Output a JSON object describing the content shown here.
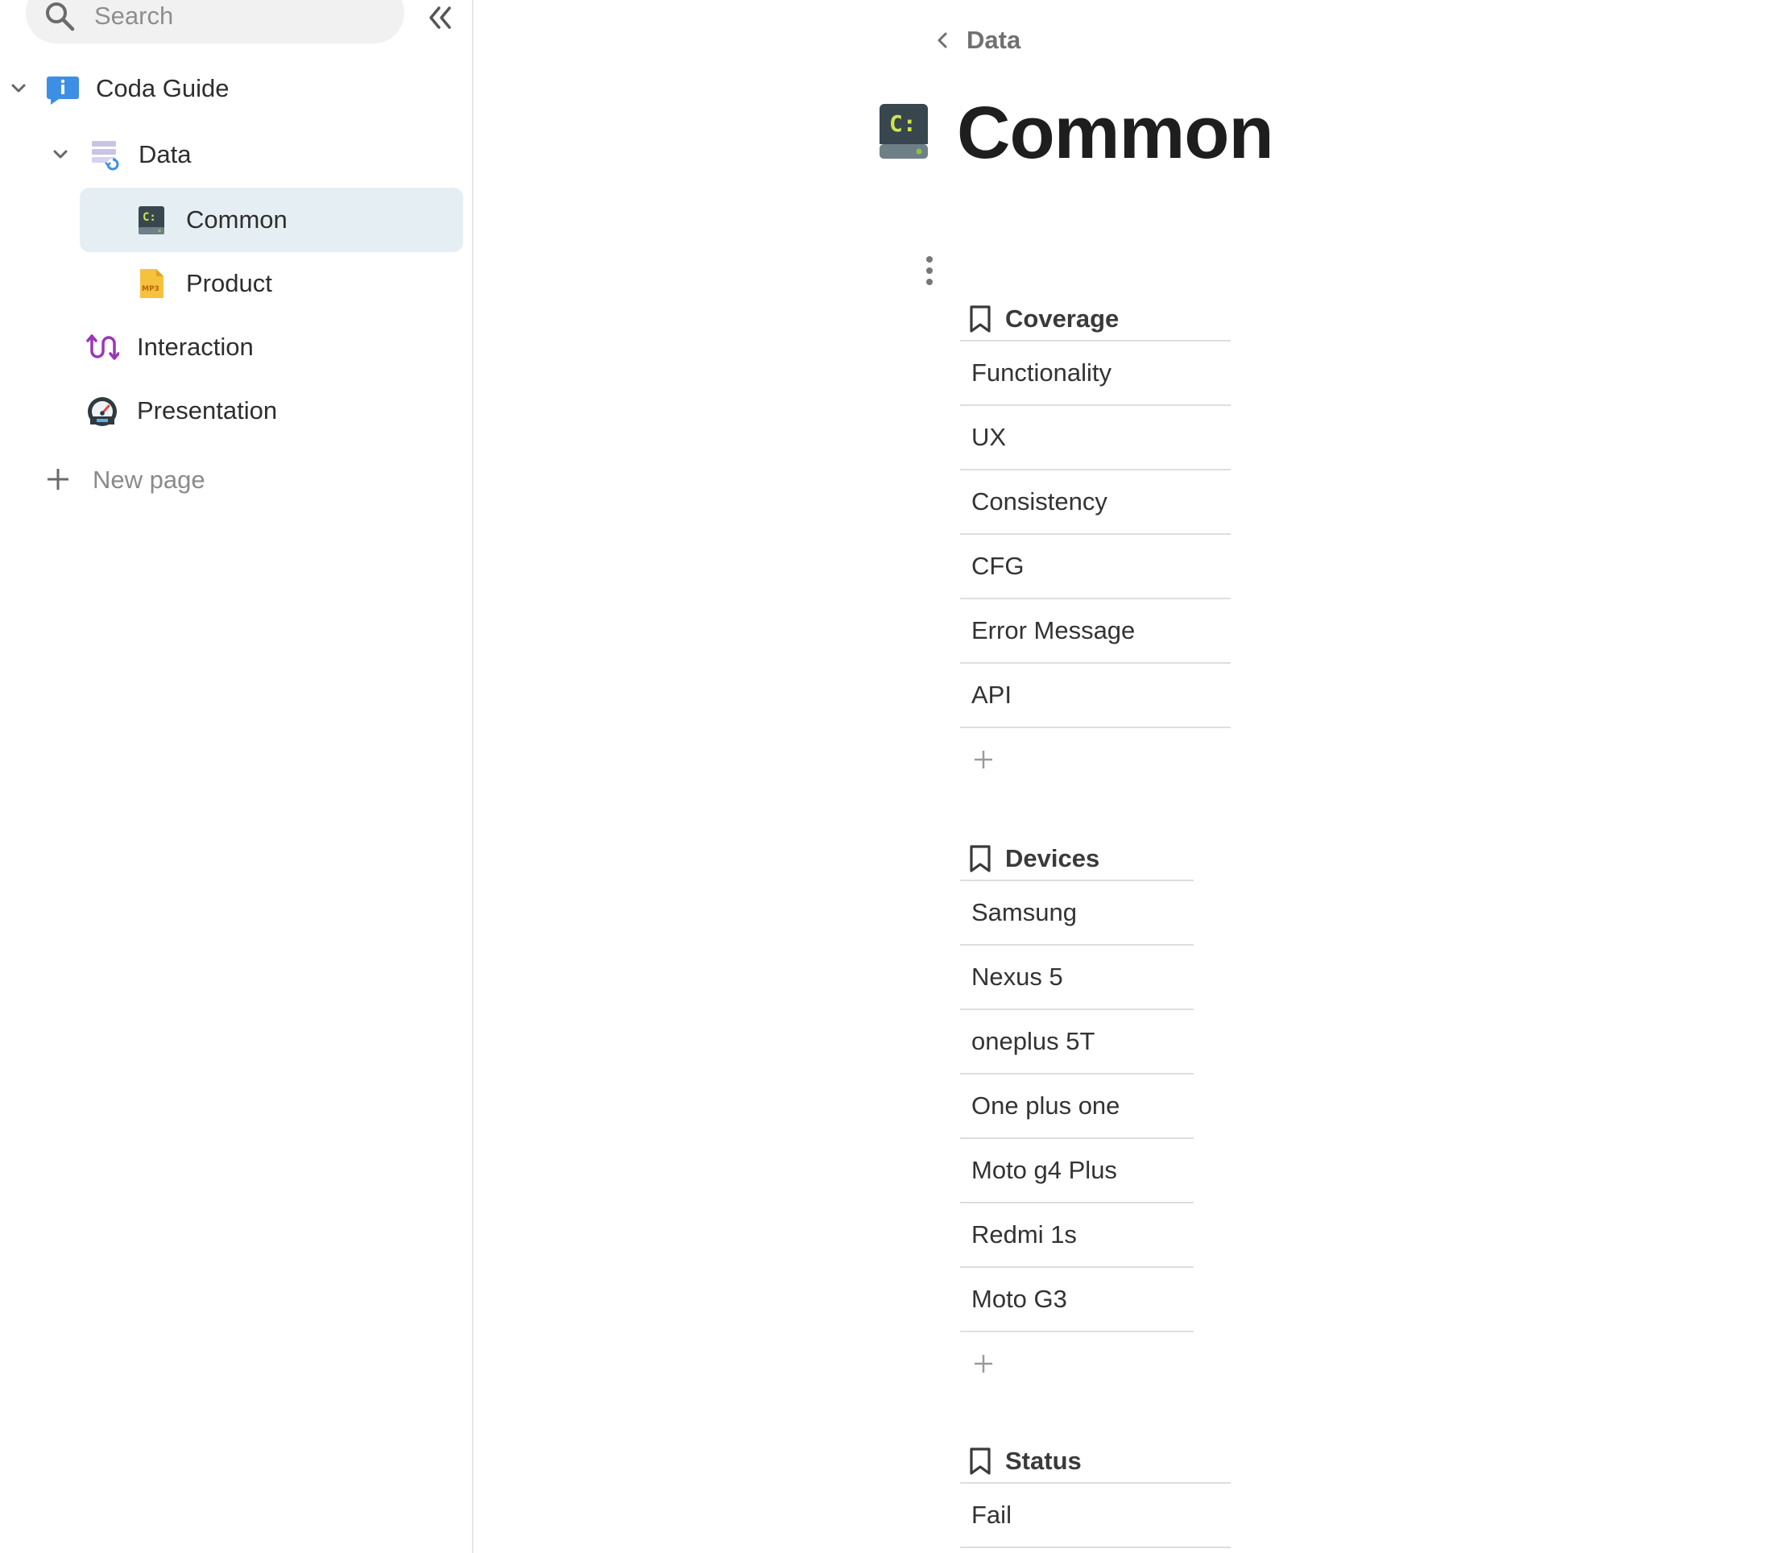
{
  "sidebar": {
    "search": {
      "placeholder": "Search",
      "icon": "search-icon"
    },
    "collapse_icon": "double-chevron-left-icon",
    "tree": [
      {
        "label": "Coda Guide",
        "icon": "info-chat-icon",
        "expanded": true
      },
      {
        "label": "Data",
        "icon": "database-icon",
        "expanded": true
      },
      {
        "label": "Common",
        "icon": "terminal-drive-icon",
        "selected": true
      },
      {
        "label": "Product",
        "icon": "mp3-file-icon"
      },
      {
        "label": "Interaction",
        "icon": "wave-arrow-icon"
      },
      {
        "label": "Presentation",
        "icon": "speedometer-icon"
      }
    ],
    "new_page": "New page"
  },
  "main": {
    "breadcrumb": "Data",
    "title": "Common",
    "title_icon": "terminal-drive-icon",
    "groups": [
      {
        "title": "Coverage",
        "items": [
          "Functionality",
          "UX",
          "Consistency",
          "CFG",
          "Error Message",
          "API"
        ]
      },
      {
        "title": "Devices",
        "items": [
          "Samsung",
          "Nexus 5",
          "oneplus 5T",
          "One plus one",
          "Moto g4 Plus",
          "Redmi 1s",
          "Moto G3"
        ]
      },
      {
        "title": "Status",
        "items": [
          "Fail"
        ]
      }
    ]
  },
  "colors": {
    "selected_bg": "#e5eef3",
    "divider": "#dedede",
    "muted_text": "#8a8a8a"
  }
}
